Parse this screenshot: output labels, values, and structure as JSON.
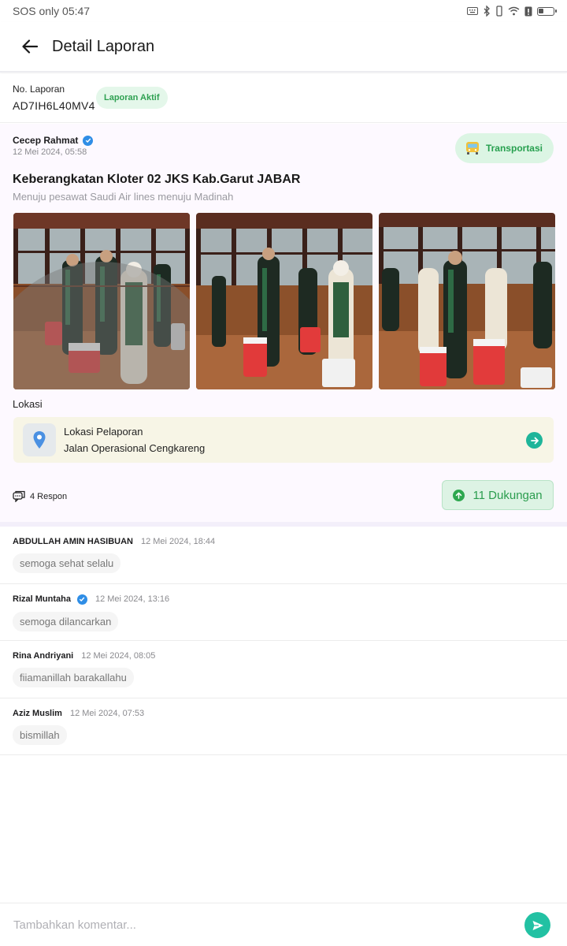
{
  "status_bar": {
    "left_text": "SOS only 05:47",
    "battery_level": 0.35
  },
  "header": {
    "title": "Detail Laporan"
  },
  "report": {
    "number_label": "No. Laporan",
    "number": "AD7IH6L40MV4",
    "status_badge": "Laporan Aktif",
    "author": "Cecep Rahmat",
    "date": "12 Mei 2024, 05:58",
    "category": "Transportasi",
    "title": "Keberangkatan Kloter 02 JKS Kab.Garut JABAR",
    "description": "Menuju pesawat Saudi Air lines menuju Madinah",
    "location_label": "Lokasi",
    "location_title": "Lokasi Pelaporan",
    "location_address": "Jalan Operasional Cengkareng",
    "responses": "4 Respon",
    "support": "11 Dukungan"
  },
  "comments": [
    {
      "name": "ABDULLAH AMIN HASIBUAN",
      "time": "12 Mei 2024, 18:44",
      "text": "semoga sehat selalu",
      "verified": false
    },
    {
      "name": "Rizal Muntaha",
      "time": "12 Mei 2024, 13:16",
      "text": "semoga dilancarkan",
      "verified": true
    },
    {
      "name": "Rina Andriyani",
      "time": "12 Mei 2024, 08:05",
      "text": "fiiamanillah barakallahu",
      "verified": false
    },
    {
      "name": "Aziz Muslim",
      "time": "12 Mei 2024, 07:53",
      "text": "bismillah",
      "verified": false
    }
  ],
  "comment_input": {
    "placeholder": "Tambahkan komentar..."
  },
  "colors": {
    "accent_green": "#2fa152",
    "teal": "#22c1a3",
    "verified_blue": "#2f8ee6"
  }
}
